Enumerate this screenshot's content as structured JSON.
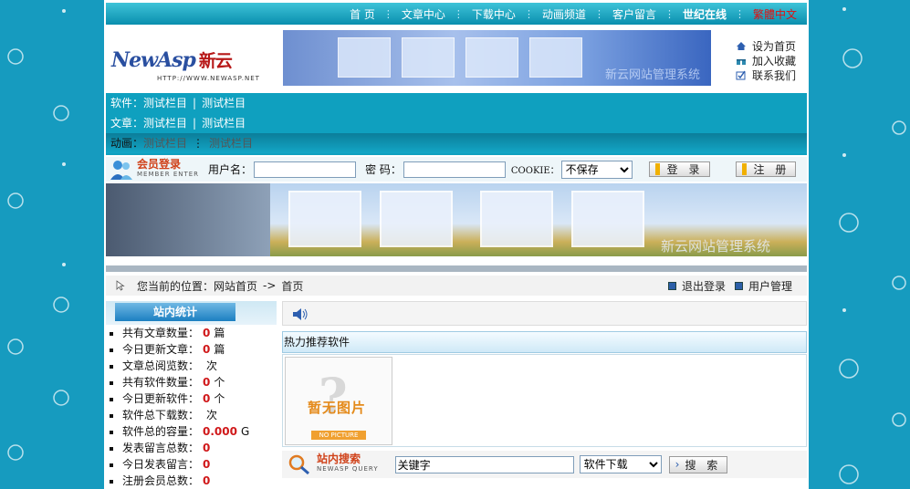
{
  "nav": {
    "items": [
      "首 页",
      "文章中心",
      "下载中心",
      "动画频道",
      "客户留言",
      "世纪在线",
      "繁體中文"
    ]
  },
  "header": {
    "logo_main": "NewAsp",
    "logo_cn": "新云",
    "logo_url": "HTTP://WWW.NEWASP.NET",
    "banner_watermark": "新云网站管理系统",
    "quick_links": [
      "设为首页",
      "加入收藏",
      "联系我们"
    ]
  },
  "categories": [
    {
      "label": "软件：",
      "links": [
        "测试栏目",
        "测试栏目"
      ]
    },
    {
      "label": "文章：",
      "links": [
        "测试栏目",
        "测试栏目"
      ]
    },
    {
      "label": "动画：",
      "links": [
        "测试栏目",
        "测试栏目"
      ]
    }
  ],
  "login": {
    "title": "会员登录",
    "subtitle": "MEMBER ENTER",
    "username_label": "用户名：",
    "password_label": "密 码：",
    "cookie_label": "COOKIE：",
    "cookie_value": "不保存",
    "login_button": "登 录",
    "register_button": "注 册"
  },
  "big_banner": {
    "watermark": "新云网站管理系统"
  },
  "location": {
    "prefix": "您当前的位置：",
    "home": "网站首页",
    "arrow": "->",
    "current": "首页",
    "logout": "退出登录",
    "user_manage": "用户管理"
  },
  "stats": {
    "title": "站内统计",
    "items": [
      {
        "label": "共有文章数量：",
        "value": "0",
        "unit": "篇"
      },
      {
        "label": "今日更新文章：",
        "value": "0",
        "unit": "篇"
      },
      {
        "label": "文章总阅览数：",
        "value": "",
        "unit": "次"
      },
      {
        "label": "共有软件数量：",
        "value": "0",
        "unit": "个"
      },
      {
        "label": "今日更新软件：",
        "value": "0",
        "unit": "个"
      },
      {
        "label": "软件总下载数：",
        "value": "",
        "unit": "次"
      },
      {
        "label": "软件总的容量：",
        "value": "0.000",
        "unit": "G"
      },
      {
        "label": "发表留言总数：",
        "value": "0",
        "unit": ""
      },
      {
        "label": "今日发表留言：",
        "value": "0",
        "unit": ""
      },
      {
        "label": "注册会员总数：",
        "value": "0",
        "unit": ""
      }
    ]
  },
  "hot": {
    "title": "热力推荐软件",
    "no_picture_cn": "暂无图片",
    "no_picture_en": "NO PICTURE"
  },
  "search": {
    "title": "站内搜索",
    "subtitle": "NEWASP QUERY",
    "input_value": "关键字",
    "select_value": "软件下载",
    "button": "搜 索"
  },
  "colors": {
    "background": "#169bbf",
    "nav_bar": "#0a8fae",
    "highlight_red": "#d0181a",
    "title_orange": "#d0421a"
  }
}
